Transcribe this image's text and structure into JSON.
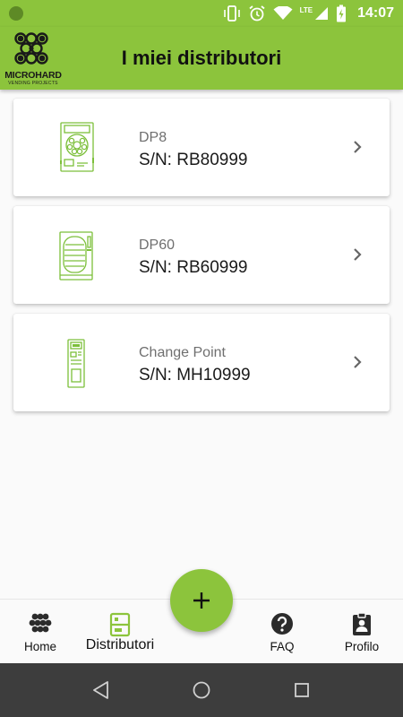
{
  "status_bar": {
    "time": "14:07",
    "network": "LTE"
  },
  "app_bar": {
    "title": "I miei distributori",
    "logo_text": "MICROHARD",
    "logo_subtext": "VENDING PROJECTS"
  },
  "machines": [
    {
      "model": "DP8",
      "serial": "S/N: RB80999",
      "image": "dp8-machine-icon"
    },
    {
      "model": "DP60",
      "serial": "S/N: RB60999",
      "image": "dp60-machine-icon"
    },
    {
      "model": "Change Point",
      "serial": "S/N: MH10999",
      "image": "change-point-machine-icon"
    }
  ],
  "fab": {
    "icon": "plus-icon"
  },
  "bottom_nav": {
    "items": [
      {
        "label": "Home",
        "icon": "dots-grid-icon"
      },
      {
        "label": "Distributori",
        "icon": "vending-machine-icon",
        "active": true
      },
      {
        "label": "FAQ",
        "icon": "help-circle-icon"
      },
      {
        "label": "Profilo",
        "icon": "badge-icon"
      }
    ]
  },
  "colors": {
    "primary": "#8cc43c",
    "icon_green": "#7cbf3a",
    "system_nav": "#3d3d3d"
  }
}
